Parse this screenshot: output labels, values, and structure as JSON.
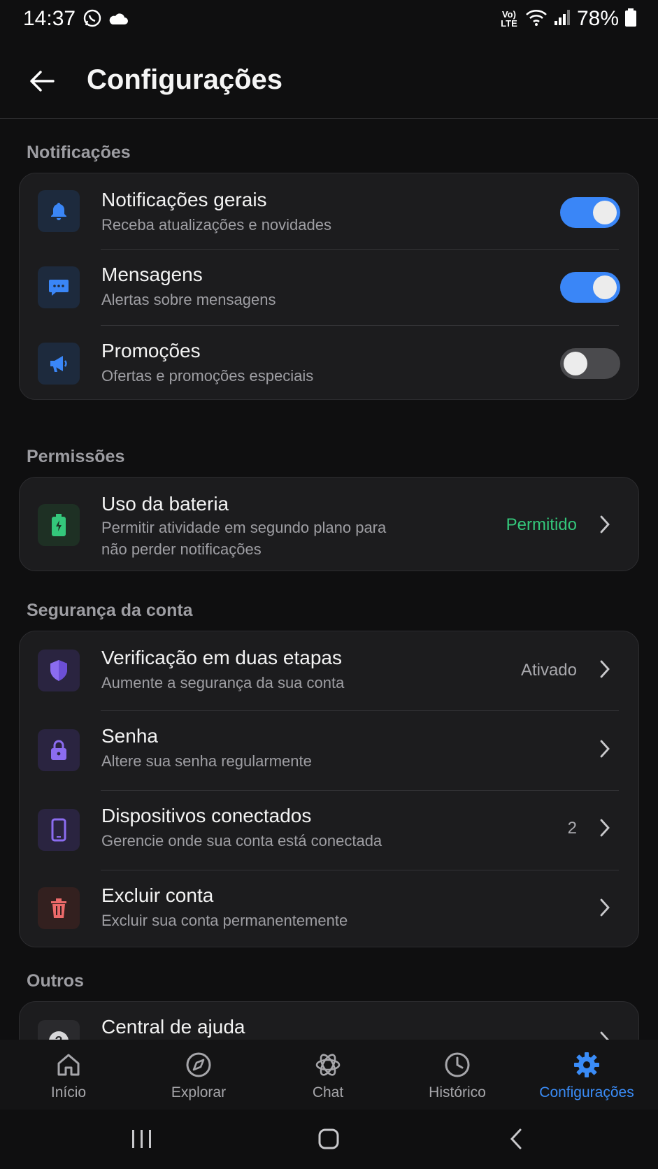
{
  "status_bar": {
    "time": "14:37",
    "network": "Vo) LTE",
    "battery": "78%"
  },
  "header": {
    "title": "Configurações"
  },
  "sections": {
    "notifications": {
      "title": "Notificações",
      "items": [
        {
          "title": "Notificações gerais",
          "subtitle": "Receba atualizações e novidades",
          "toggle_on": true,
          "icon": "bell-icon"
        },
        {
          "title": "Mensagens",
          "subtitle": "Alertas sobre mensagens",
          "toggle_on": true,
          "icon": "chat-bubble-icon"
        },
        {
          "title": "Promoções",
          "subtitle": "Ofertas e promoções especiais",
          "toggle_on": false,
          "icon": "megaphone-icon"
        }
      ]
    },
    "permissions": {
      "title": "Permissões",
      "items": [
        {
          "title": "Uso da bateria",
          "subtitle": "Permitir atividade em segundo plano para não perder notificações",
          "value": "Permitido",
          "icon": "battery-icon"
        }
      ]
    },
    "security": {
      "title": "Segurança da conta",
      "items": [
        {
          "title": "Verificação em duas etapas",
          "subtitle": "Aumente a segurança da sua conta",
          "value": "Ativado",
          "icon": "shield-icon"
        },
        {
          "title": "Senha",
          "subtitle": "Altere sua senha regularmente",
          "value": "",
          "icon": "lock-icon"
        },
        {
          "title": "Dispositivos conectados",
          "subtitle": "Gerencie onde sua conta está conectada",
          "value": "2",
          "icon": "phone-icon"
        },
        {
          "title": "Excluir conta",
          "subtitle": "Excluir sua conta permanentemente",
          "value": "",
          "icon": "trash-icon"
        }
      ]
    },
    "others": {
      "title": "Outros",
      "items": [
        {
          "title": "Central de ajuda",
          "icon": "help-icon"
        }
      ]
    }
  },
  "bottom_nav": {
    "items": [
      {
        "label": "Início",
        "icon": "home-icon",
        "active": false
      },
      {
        "label": "Explorar",
        "icon": "compass-icon",
        "active": false
      },
      {
        "label": "Chat",
        "icon": "chat-logo-icon",
        "active": false
      },
      {
        "label": "Histórico",
        "icon": "clock-icon",
        "active": false
      },
      {
        "label": "Configurações",
        "icon": "gear-icon",
        "active": true
      }
    ]
  },
  "colors": {
    "accent": "#3a86f7",
    "allowed_green": "#34c77b",
    "background": "#0f0f10",
    "card": "#1c1c1e"
  }
}
